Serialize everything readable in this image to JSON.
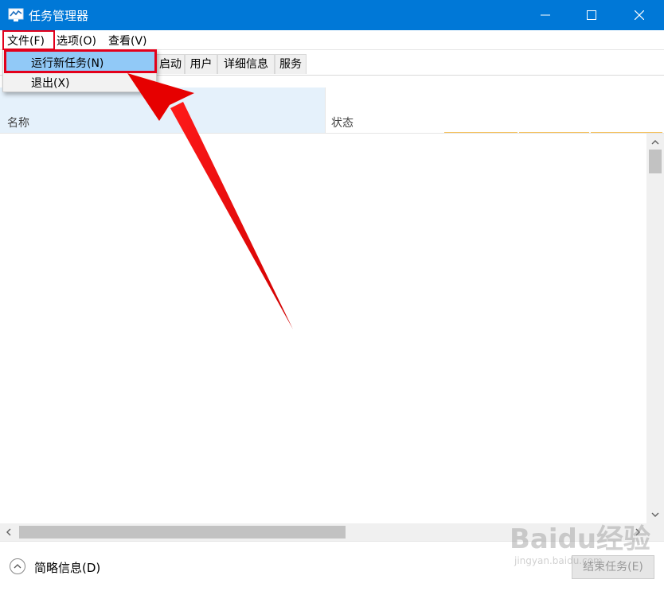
{
  "window": {
    "title": "任务管理器",
    "minimize_glyph": "—",
    "maximize_glyph": "□",
    "close_glyph": "✕"
  },
  "menubar": {
    "items": [
      {
        "label": "文件(F)"
      },
      {
        "label": "选项(O)"
      },
      {
        "label": "查看(V)"
      }
    ]
  },
  "file_menu": {
    "items": [
      {
        "label": "运行新任务(N)",
        "highlighted": true
      },
      {
        "label": "退出(X)"
      }
    ]
  },
  "tabs": [
    {
      "label": "启动"
    },
    {
      "label": "用户"
    },
    {
      "label": "详细信息"
    },
    {
      "label": "服务"
    }
  ],
  "columns": {
    "name": "名称",
    "status": "状态"
  },
  "footer": {
    "brief_info": "简略信息(D)",
    "end_task": "结束任务(E)"
  },
  "watermark": {
    "logo": "Baidu经验",
    "url": "jingyan.baidu.com"
  },
  "colors": {
    "titlebar": "#0078d7",
    "highlight_box": "#e3001b",
    "menu_highlight": "#91c9f7",
    "column_selected": "#e5f1fb"
  }
}
